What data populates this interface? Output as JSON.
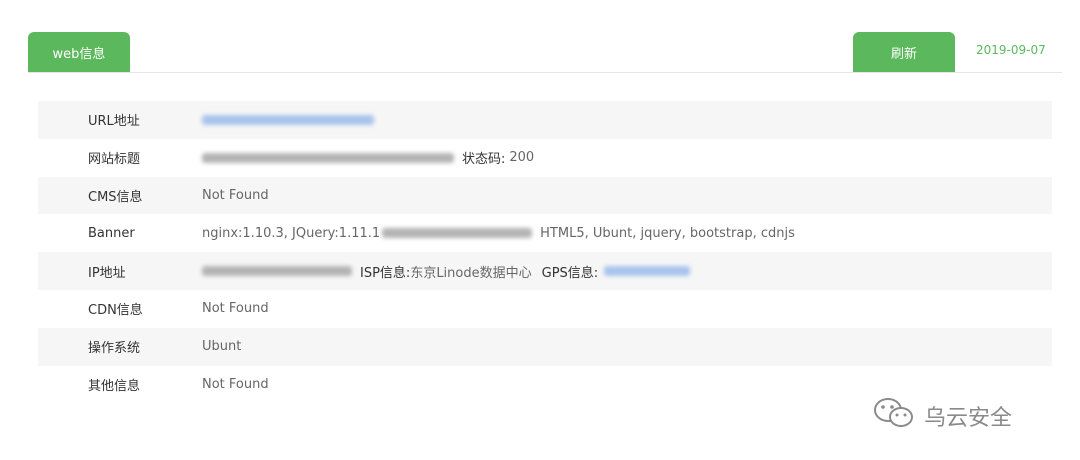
{
  "tabs": {
    "web_info": "web信息"
  },
  "toolbar": {
    "refresh_label": "刷新",
    "date": "2019-09-07"
  },
  "rows": [
    {
      "label": "URL地址",
      "value": ""
    },
    {
      "label": "网站标题",
      "status_label": "状态码:",
      "status_code": "200"
    },
    {
      "label": "CMS信息",
      "value": "Not Found"
    },
    {
      "label": "Banner",
      "value_prefix": "nginx:1.10.3,  JQuery:1.11.1",
      "value_suffix": "HTML5,  Ubunt,  jquery,  bootstrap,  cdnjs"
    },
    {
      "label": "IP地址",
      "isp_label": "ISP信息:",
      "isp_value": "东京Linode数据中心",
      "gps_label": "GPS信息:"
    },
    {
      "label": "CDN信息",
      "value": "Not Found"
    },
    {
      "label": "操作系统",
      "value": "Ubunt"
    },
    {
      "label": "其他信息",
      "value": "Not Found"
    }
  ],
  "watermark": {
    "text": "乌云安全",
    "icon": "wechat-icon"
  },
  "colors": {
    "accent": "#5cb85c",
    "row_stripe": "#f6f6f6",
    "redacted_link": "#a9c3ec"
  }
}
